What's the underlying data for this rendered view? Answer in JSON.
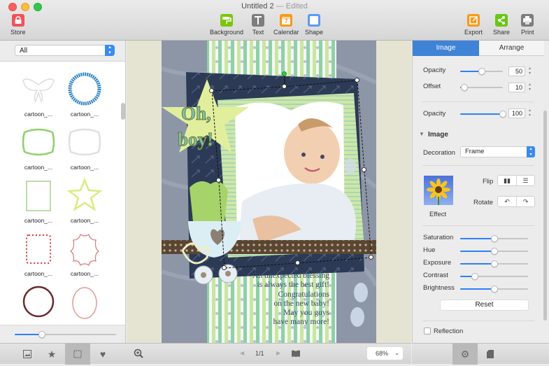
{
  "window": {
    "title": "Untitled 2",
    "separator": "—",
    "status": "Edited"
  },
  "toolbar": {
    "store": {
      "label": "Store",
      "icon": "bag-icon",
      "color": "#f4505a"
    },
    "background": {
      "label": "Background",
      "icon": "paint-roller-icon",
      "color": "#7ac70c"
    },
    "text": {
      "label": "Text",
      "icon": "text-icon",
      "color": "#7d7d7d"
    },
    "calendar": {
      "label": "Calendar",
      "icon": "calendar-icon",
      "color": "#f79a1e",
      "day": "7"
    },
    "shape": {
      "label": "Shape",
      "icon": "shape-icon",
      "color": "#5b9cf2"
    },
    "export": {
      "label": "Export",
      "icon": "export-icon",
      "color": "#f79a1e"
    },
    "share": {
      "label": "Share",
      "icon": "share-icon",
      "color": "#6cc417"
    },
    "print": {
      "label": "Print",
      "icon": "printer-icon",
      "color": "#7d7d7d"
    }
  },
  "library": {
    "filter": {
      "selected": "All"
    },
    "items": [
      {
        "label": "cartoon_...",
        "shape": "butterfly",
        "color": "#dcdcdc"
      },
      {
        "label": "cartoon_...",
        "shape": "circle-ring",
        "color": "#2f84c2"
      },
      {
        "label": "cartoon_...",
        "shape": "wavy-rect",
        "color": "#8fd16a"
      },
      {
        "label": "cartoon_...",
        "shape": "wavy-rect",
        "color": "#e0e0e0"
      },
      {
        "label": "cartoon_...",
        "shape": "rect-frame",
        "color": "#a7cf8e"
      },
      {
        "label": "cartoon_...",
        "shape": "star",
        "color": "#d8ec82"
      },
      {
        "label": "cartoon_...",
        "shape": "dotted-rect",
        "color": "#e8323c"
      },
      {
        "label": "cartoon_...",
        "shape": "ornate-frame",
        "color": "#d07a7a"
      },
      {
        "label": "cartoon_...",
        "shape": "circle",
        "color": "#6b2a2e"
      },
      {
        "label": "cartoon_...",
        "shape": "egg",
        "color": "#e09a94"
      }
    ],
    "thumb_size_fraction": 0.27,
    "tabs": [
      {
        "name": "photos",
        "icon": "image-icon"
      },
      {
        "name": "favorites",
        "icon": "star-icon"
      },
      {
        "name": "frames",
        "icon": "frame-icon",
        "active": true
      },
      {
        "name": "stickers",
        "icon": "heart-icon"
      }
    ]
  },
  "canvas": {
    "title_art": "Oh, boy!",
    "message_lines": [
      "An unexpected blessing",
      "is always the best gift!",
      "Congratulations",
      "on the new baby!",
      "May you guys",
      "have many more!"
    ],
    "page_indicator": "1/1",
    "zoom": "68%"
  },
  "properties": {
    "tabs": {
      "image": "Image",
      "arrange": "Arrange"
    },
    "shadow": {
      "opacity_label": "Opacity",
      "opacity_value": "50",
      "opacity_fraction": 0.5,
      "offset_label": "Offset",
      "offset_value": "10",
      "offset_fraction": 0.1
    },
    "opacity": {
      "label": "Opacity",
      "value": "100",
      "fraction": 1.0
    },
    "image_section": {
      "title": "Image",
      "decoration_label": "Decoration",
      "decoration_value": "Frame",
      "flip_label": "Flip",
      "rotate_label": "Rotate",
      "effect_label": "Effect"
    },
    "adjustments": [
      {
        "label": "Saturation",
        "fraction": 0.5
      },
      {
        "label": "Hue",
        "fraction": 0.5
      },
      {
        "label": "Exposure",
        "fraction": 0.5
      },
      {
        "label": "Contrast",
        "fraction": 0.22
      },
      {
        "label": "Brightness",
        "fraction": 0.5
      }
    ],
    "reset_label": "Reset",
    "reflection_label": "Reflection",
    "reflection_checked": false,
    "bottom_tabs": [
      {
        "name": "settings",
        "icon": "gear-icon",
        "active": true
      },
      {
        "name": "document",
        "icon": "document-icon"
      }
    ]
  },
  "accent": "#2d7ff9"
}
